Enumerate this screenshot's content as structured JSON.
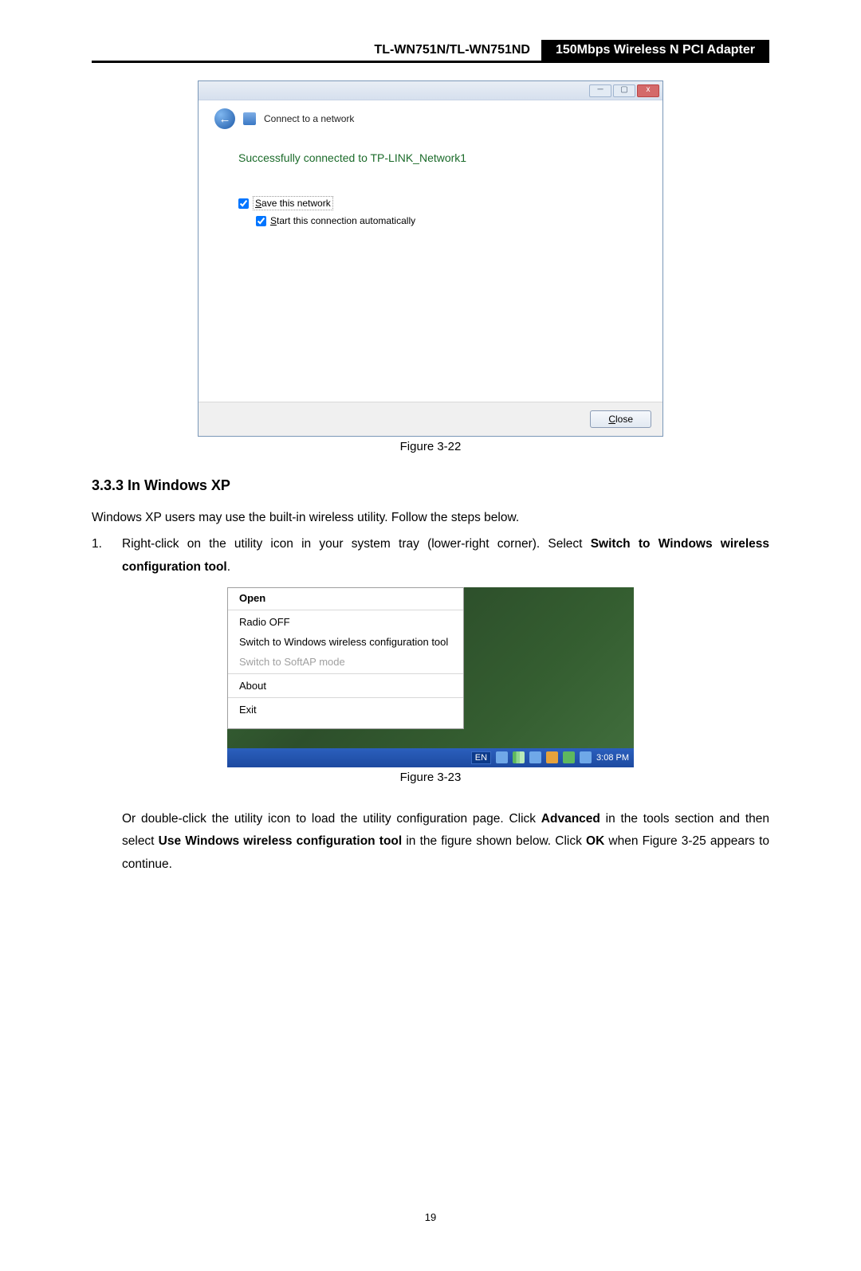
{
  "header": {
    "model": "TL-WN751N/TL-WN751ND",
    "desc": "150Mbps Wireless N PCI Adapter"
  },
  "dialog1": {
    "title_crumb": "Connect to a network",
    "success": "Successfully connected to TP-LINK_Network1",
    "save_prefix": "S",
    "save_rest": "ave this network",
    "start_prefix": "S",
    "start_rest_before": "tart this connection automatically",
    "close": "Close",
    "min": "─",
    "max": "▢",
    "x": "x"
  },
  "caption1": "Figure 3-22",
  "section": {
    "num_title": "3.3.3  In Windows XP"
  },
  "para1": "Windows XP users may use the built-in wireless utility. Follow the steps below.",
  "step1": {
    "num": "1.",
    "text_before": "Right-click on the utility icon in your system tray (lower-right corner). Select ",
    "bold1": "Switch to Windows wireless configuration tool",
    "after": "."
  },
  "ctx": {
    "open": "Open",
    "radio": "Radio OFF",
    "switch_win": "Switch to Windows wireless configuration tool",
    "switch_soft": "Switch to SoftAP mode",
    "about": "About",
    "exit": "Exit",
    "lang": "EN",
    "time": "3:08 PM"
  },
  "caption2": "Figure 3-23",
  "para2_a": "Or double-click the utility icon to load the utility configuration page. Click ",
  "para2_bold1": "Advanced",
  "para2_b": " in the tools section and then select ",
  "para2_bold2": "Use Windows wireless configuration tool",
  "para2_c": " in the figure shown below. Click ",
  "para2_bold3": "OK",
  "para2_d": " when Figure 3-25 appears to continue.",
  "page_num": "19"
}
